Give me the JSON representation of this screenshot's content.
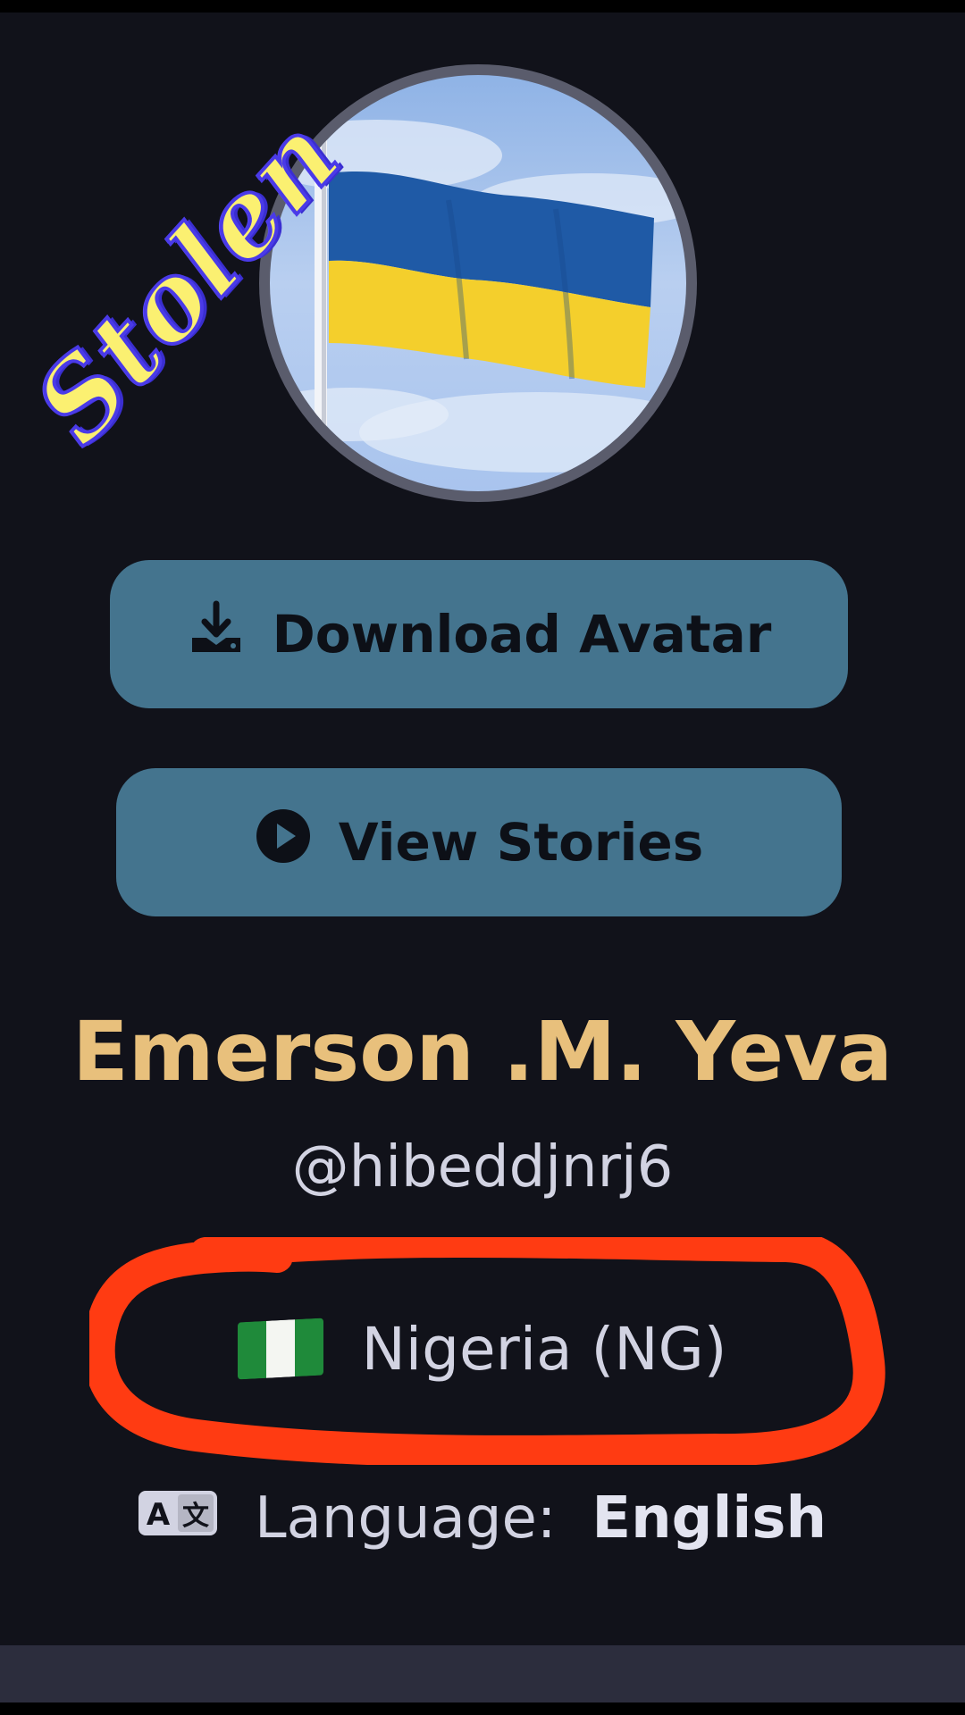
{
  "stamp": {
    "text": "Stolen"
  },
  "profile": {
    "avatar_description_icon": "ukraine-flag-avatar",
    "name": "Emerson .M. Yeva",
    "handle": "@hibeddjnrj6",
    "country": "Nigeria (NG)",
    "country_flag_icon": "nigeria-flag-icon",
    "language_label": "Language:",
    "language_value": "English",
    "language_icon": "translate-icon"
  },
  "actions": {
    "download_avatar_label": "Download Avatar",
    "download_icon": "download-icon",
    "view_stories_label": "View Stories",
    "play_icon": "play-circle-icon"
  },
  "colors": {
    "background": "#11121a",
    "button": "#44748e",
    "name": "#e8c07c",
    "highlight": "#ff3b12",
    "stamp_fill": "#fbf071",
    "stamp_stroke": "#4a3ae8"
  }
}
